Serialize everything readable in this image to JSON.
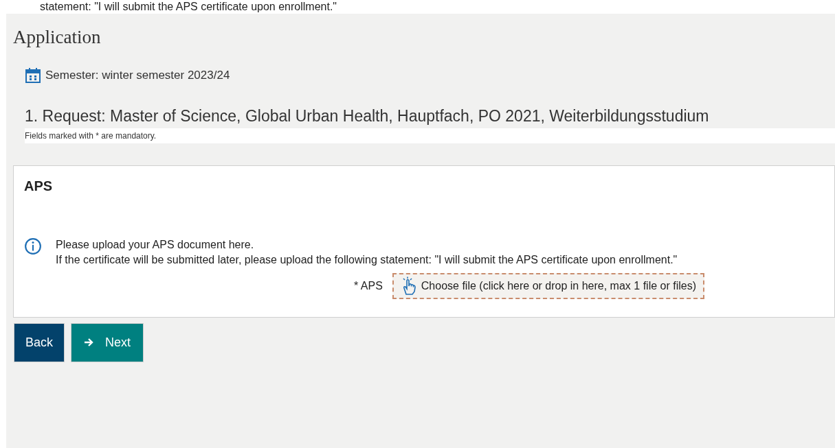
{
  "top_fragment": "statement: \"I will submit the APS certificate upon enrollment.\"",
  "page_title": "Application",
  "semester": "Semester: winter semester 2023/24",
  "request": "1. Request: Master of Science, Global Urban Health, Hauptfach, PO 2021, Weiterbildungsstudium",
  "mandatory_note": "Fields marked with * are mandatory.",
  "section": {
    "title": "APS",
    "info_lines": [
      "Please upload your APS document here.",
      "If the certificate will be submitted later, please upload the following statement: \"I will submit the APS certificate upon enrollment.\""
    ],
    "upload": {
      "label": "* APS",
      "text": "Choose file (click here or drop in here, max 1 file or files)"
    }
  },
  "buttons": [
    {
      "label": "Back",
      "kind": "back"
    },
    {
      "label": "Next",
      "kind": "next"
    }
  ]
}
